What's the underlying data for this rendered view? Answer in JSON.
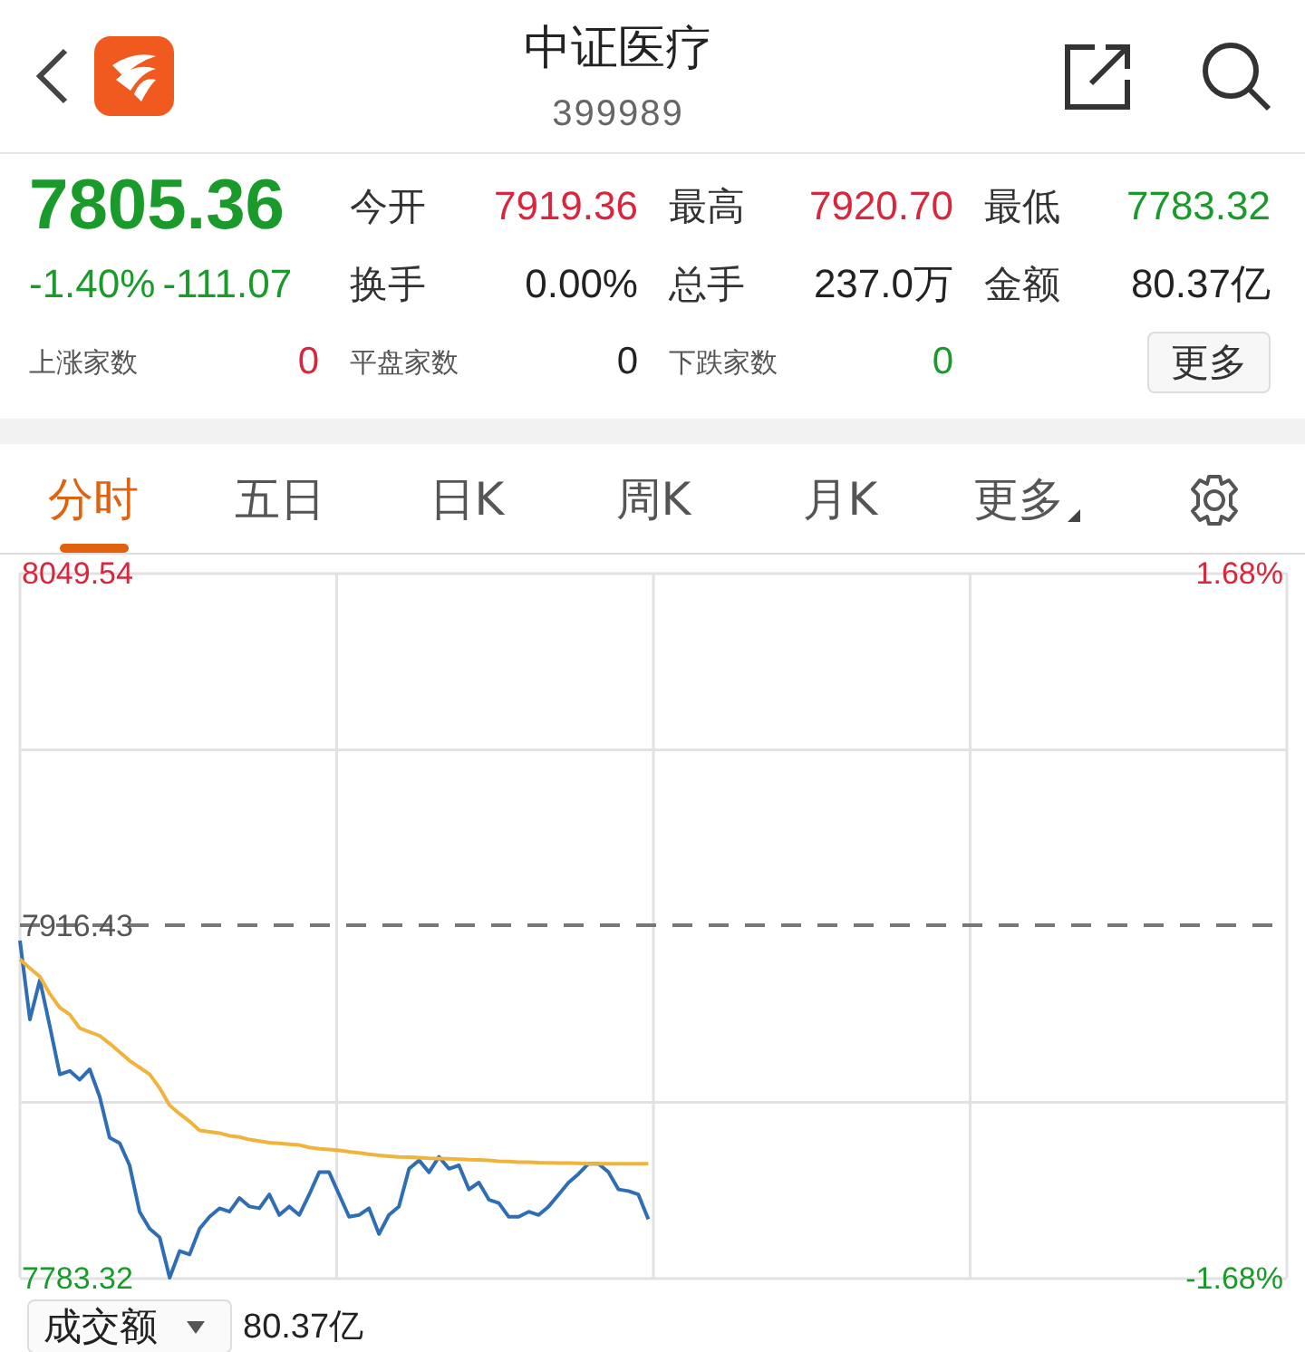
{
  "header": {
    "title": "中证医疗",
    "code": "399989"
  },
  "quote": {
    "price": "7805.36",
    "color": "#1a9a2a",
    "change_percent": "-1.40%",
    "change": "-111.07",
    "stats": [
      {
        "label": "今开",
        "value": "7919.36",
        "color": "#d7263d"
      },
      {
        "label": "最高",
        "value": "7920.70",
        "color": "#d7263d"
      },
      {
        "label": "最低",
        "value": "7783.32",
        "color": "#1a9a2a"
      },
      {
        "label": "换手",
        "value": "0.00%",
        "color": "#222222"
      },
      {
        "label": "总手",
        "value": "237.0万",
        "color": "#222222"
      },
      {
        "label": "金额",
        "value": "80.37亿",
        "color": "#222222"
      }
    ],
    "counts": [
      {
        "label": "上涨家数",
        "value": "0",
        "color": "#d7263d"
      },
      {
        "label": "平盘家数",
        "value": "0",
        "color": "#222222"
      },
      {
        "label": "下跌家数",
        "value": "0",
        "color": "#1a9a2a"
      }
    ],
    "more_button": "更多"
  },
  "tabs": [
    {
      "label": "分时",
      "selected": true,
      "kind": "tab"
    },
    {
      "label": "五日",
      "selected": false,
      "kind": "tab"
    },
    {
      "label": "日K",
      "selected": false,
      "kind": "tab"
    },
    {
      "label": "周K",
      "selected": false,
      "kind": "tab"
    },
    {
      "label": "月K",
      "selected": false,
      "kind": "tab"
    },
    {
      "label": "更多",
      "selected": false,
      "kind": "menu"
    }
  ],
  "chart": {
    "percent_labels": [
      {
        "text": "1.68%",
        "color": "#d7263d"
      },
      {
        "text": "-1.68%",
        "color": "#1a9a2a"
      }
    ],
    "chart_data": {
      "type": "line",
      "ylim": [
        7783.32,
        8049.54
      ],
      "yticks": [
        {
          "value": 8049.54,
          "label": "8049.54"
        },
        {
          "value": 7916.43,
          "label": "7916.43"
        },
        {
          "value": 7783.32,
          "label": "7783.32"
        }
      ],
      "ref_lines": [
        {
          "axis": "y",
          "value": 7916.43
        }
      ],
      "categories": [
        null,
        null,
        null,
        null,
        null,
        null,
        null,
        null,
        null,
        null,
        null,
        null,
        null,
        null,
        null,
        null,
        null,
        null,
        null,
        null,
        null,
        null,
        null,
        null,
        null,
        null,
        null,
        null,
        null,
        null,
        null,
        null,
        null,
        null,
        null,
        null,
        null,
        null,
        null,
        null,
        null,
        null,
        null,
        null,
        null,
        null,
        null,
        null,
        null,
        null,
        null,
        null,
        null,
        null,
        null,
        null,
        null,
        null,
        null,
        null,
        null,
        null,
        null,
        null,
        null,
        null,
        null,
        null,
        null,
        null,
        null,
        null,
        null,
        null,
        null,
        null,
        null,
        null,
        null,
        null,
        null,
        null,
        null,
        null,
        null,
        null,
        null,
        null,
        null,
        null,
        null,
        null,
        null,
        null,
        null,
        null,
        null,
        null,
        null,
        null,
        null,
        null,
        null,
        null,
        null,
        null,
        null,
        null,
        null,
        null,
        null,
        null,
        null,
        null,
        null,
        null,
        null,
        null,
        null,
        null,
        null,
        null,
        null,
        null,
        null,
        null,
        null,
        null
      ],
      "series": [
        {
          "color": "#2f6db5",
          "values": [
            7910.6,
            7880.81,
            7895.7,
            7878.22,
            7860.08,
            7861.38,
            7858.14,
            7862.02,
            7851.66,
            7836.12,
            7834.17,
            7825.75,
            7808.26,
            7801.79,
            7798.55,
            7783.32,
            7793.37,
            7792.07,
            7801.79,
            7806.32,
            7809.56,
            7808.26,
            7813.45,
            7810.21,
            7809.56,
            7814.74,
            7806.97,
            7810.21,
            7806.97,
            7814.74,
            7823.16,
            7823.16,
            7814.74,
            7806.32,
            7806.97,
            7809.56,
            7799.84,
            7806.97,
            7810.21,
            7824.46,
            7827.7,
            7823.16,
            7828.99,
            7824.46,
            7825.75,
            7816.68,
            7819.27,
            7812.8,
            7811.5,
            7806.32,
            7806.32,
            7808.26,
            7806.97,
            7810.21,
            7814.74,
            7819.27,
            7822.51,
            7826.4,
            7826.4,
            7823.16,
            7816.68,
            7816.04,
            7814.74,
            7805.36,
            null,
            null,
            null,
            null,
            null,
            null,
            null,
            null,
            null,
            null,
            null,
            null,
            null,
            null,
            null,
            null,
            null,
            null,
            null,
            null,
            null,
            null,
            null,
            null,
            null,
            null,
            null,
            null,
            null,
            null,
            null,
            null,
            null,
            null,
            null,
            null,
            null,
            null,
            null,
            null,
            null,
            null,
            null,
            null,
            null,
            null,
            null,
            null,
            null,
            null,
            null,
            null,
            null,
            null,
            null,
            null,
            null,
            null,
            null,
            null,
            null,
            null,
            null,
            null
          ]
        },
        {
          "color": "#f0b43c",
          "values": [
            7903.48,
            7900.2,
            7897.0,
            7890.52,
            7885.3,
            7882.7,
            7877.57,
            7876.1,
            7874.7,
            7871.74,
            7868.5,
            7865.26,
            7862.7,
            7860.1,
            7854.9,
            7848.4,
            7845.18,
            7842.3,
            7838.9,
            7838.4,
            7837.9,
            7836.9,
            7836.4,
            7835.47,
            7834.9,
            7834.3,
            7834.0,
            7833.7,
            7833.4,
            7832.5,
            7832.0,
            7831.8,
            7831.4,
            7830.9,
            7830.5,
            7829.9,
            7829.5,
            7829.2,
            7828.9,
            7828.8,
            7828.6,
            7828.4,
            7828.34,
            7828.2,
            7828.1,
            7827.9,
            7827.8,
            7827.6,
            7827.3,
            7827.2,
            7827.0,
            7827.0,
            7826.8,
            7826.7,
            7826.6,
            7826.6,
            7826.5,
            7826.4,
            7826.4,
            7826.4,
            7826.4,
            7826.4,
            7826.4,
            7826.4,
            null,
            null,
            null,
            null,
            null,
            null,
            null,
            null,
            null,
            null,
            null,
            null,
            null,
            null,
            null,
            null,
            null,
            null,
            null,
            null,
            null,
            null,
            null,
            null,
            null,
            null,
            null,
            null,
            null,
            null,
            null,
            null,
            null,
            null,
            null,
            null,
            null,
            null,
            null,
            null,
            null,
            null,
            null,
            null,
            null,
            null,
            null,
            null,
            null,
            null,
            null,
            null,
            null,
            null,
            null,
            null,
            null,
            null,
            null,
            null,
            null,
            null,
            null,
            null
          ]
        }
      ]
    }
  },
  "volume": {
    "selector": "成交额",
    "value": "80.37亿"
  }
}
